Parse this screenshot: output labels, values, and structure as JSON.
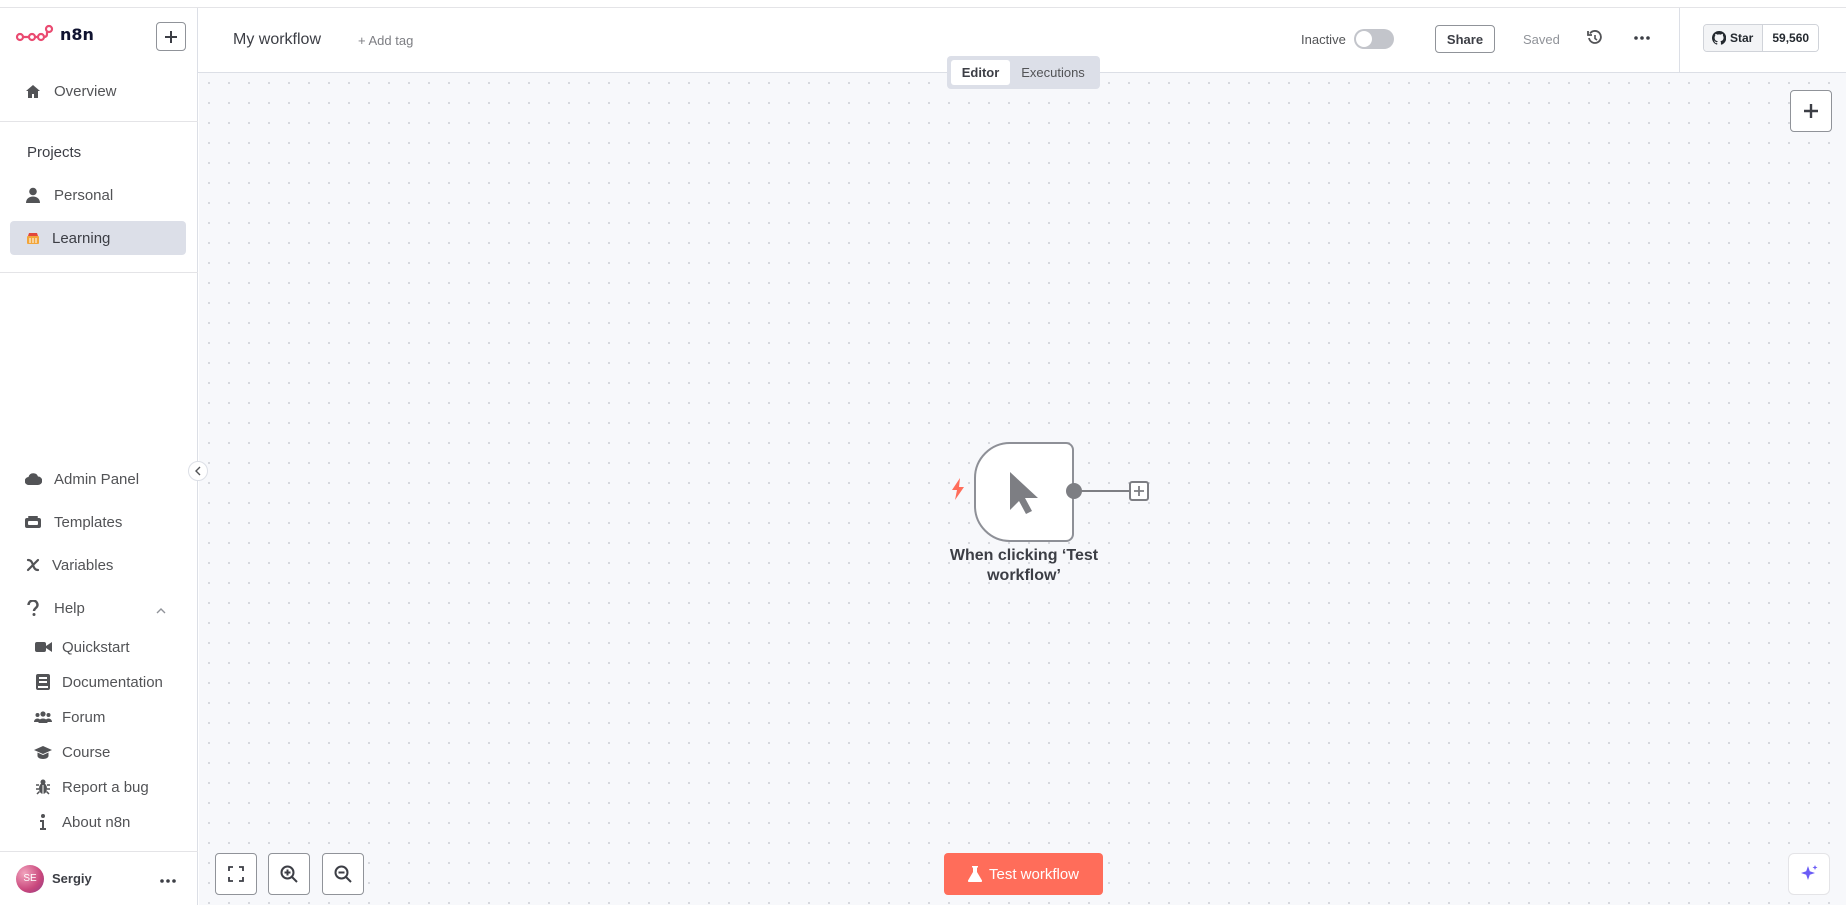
{
  "app": {
    "name": "n8n",
    "brand_color": "#ea4b71",
    "accent_color": "#ff6d5a"
  },
  "sidebar": {
    "overview": "Overview",
    "projects_title": "Projects",
    "projects": [
      {
        "label": "Personal",
        "icon": "user-icon"
      },
      {
        "label": "Learning",
        "icon": "emoji-icon",
        "active": true
      }
    ],
    "bottom": [
      {
        "label": "Admin Panel",
        "icon": "cloud-icon"
      },
      {
        "label": "Templates",
        "icon": "box-icon"
      },
      {
        "label": "Variables",
        "icon": "variable-icon"
      },
      {
        "label": "Help",
        "icon": "question-icon"
      }
    ],
    "help_items": [
      {
        "label": "Quickstart",
        "icon": "video-icon"
      },
      {
        "label": "Documentation",
        "icon": "book-icon"
      },
      {
        "label": "Forum",
        "icon": "users-icon"
      },
      {
        "label": "Course",
        "icon": "graduation-cap-icon"
      },
      {
        "label": "Report a bug",
        "icon": "bug-icon"
      },
      {
        "label": "About n8n",
        "icon": "info-icon"
      }
    ],
    "user": {
      "initials": "SE",
      "name": "Sergiy"
    }
  },
  "header": {
    "workflow_name": "My workflow",
    "add_tag": "+ Add tag",
    "status_label": "Inactive",
    "share": "Share",
    "saved": "Saved",
    "github": {
      "star": "Star",
      "count": "59,560"
    }
  },
  "tabs": [
    {
      "label": "Editor",
      "active": true
    },
    {
      "label": "Executions",
      "active": false
    }
  ],
  "canvas": {
    "node": {
      "label": "When clicking ‘Test workflow’",
      "icon": "cursor-icon"
    },
    "test_button": "Test workflow"
  }
}
